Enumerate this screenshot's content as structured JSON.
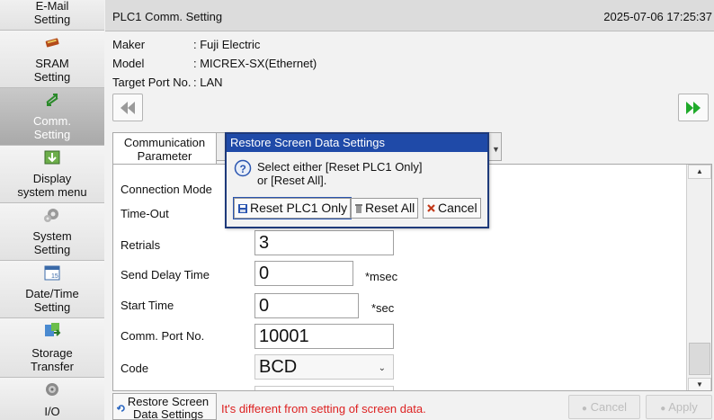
{
  "sidebar": {
    "items": [
      {
        "label": "E-Mail\nSetting",
        "icon": "email-icon"
      },
      {
        "label": "SRAM\nSetting",
        "icon": "sram-icon"
      },
      {
        "label": "Comm.\nSetting",
        "icon": "comm-icon",
        "active": true
      },
      {
        "label": "Display\nsystem menu",
        "icon": "display-download-icon"
      },
      {
        "label": "System\nSetting",
        "icon": "gear-icon"
      },
      {
        "label": "Date/Time\nSetting",
        "icon": "calendar-icon"
      },
      {
        "label": "Storage\nTransfer",
        "icon": "storage-transfer-icon"
      },
      {
        "label": "I/O",
        "icon": "io-icon"
      }
    ]
  },
  "header": {
    "title": "PLC1 Comm. Setting",
    "datetime": "2025-07-06 17:25:37"
  },
  "info": {
    "maker_key": "Maker",
    "maker_val": ": Fuji Electric",
    "model_key": "Model",
    "model_val": ": MICREX-SX(Ethernet)",
    "port_key": "Target Port No.",
    "port_val": ": LAN"
  },
  "tabs": {
    "communication_parameter": "Communication\nParameter"
  },
  "form": {
    "connection_mode_label": "Connection Mode",
    "timeout_label": "Time-Out",
    "retrials_label": "Retrials",
    "retrials_value": "3",
    "send_delay_label": "Send Delay Time",
    "send_delay_value": "0",
    "send_delay_unit": "*msec",
    "start_time_label": "Start Time",
    "start_time_value": "0",
    "start_time_unit": "*sec",
    "comm_port_label": "Comm. Port No.",
    "comm_port_value": "10001",
    "code_label": "Code",
    "code_value": "BCD"
  },
  "bottom": {
    "restore_label": "Restore Screen\nData Settings",
    "status_message": "It's different from setting of screen data.",
    "cancel_label": "Cancel",
    "apply_label": "Apply"
  },
  "dialog": {
    "title": "Restore Screen Data Settings",
    "message": "Select either [Reset PLC1 Only]\nor [Reset All].",
    "reset_plc1_label": "Reset PLC1 Only",
    "reset_all_label": "Reset All",
    "cancel_label": "Cancel"
  },
  "colors": {
    "dialog_title_bg": "#1f4aa8",
    "status_text": "#dd2222",
    "nav_arrow_green": "#1faa2a"
  }
}
